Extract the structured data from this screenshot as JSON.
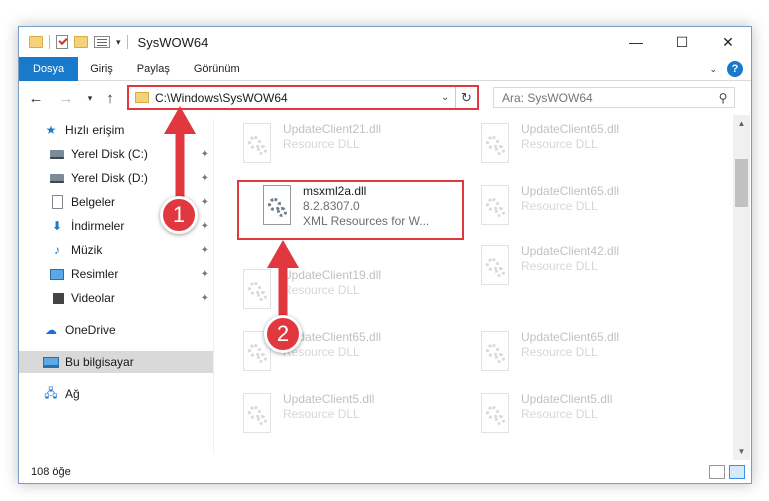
{
  "window": {
    "title": "SysWOW64",
    "controls": {
      "minimize": "—",
      "maximize": "☐",
      "close": "✕"
    }
  },
  "ribbon": {
    "tabs": [
      "Dosya",
      "Giriş",
      "Paylaş",
      "Görünüm"
    ],
    "help": "?"
  },
  "address": {
    "path": "C:\\Windows\\SysWOW64",
    "search_placeholder": "Ara: SysWOW64"
  },
  "sidebar": {
    "quick_access": "Hızlı erişim",
    "items": [
      {
        "label": "Yerel Disk (C:)",
        "icon": "disk-icon",
        "pinned": true
      },
      {
        "label": "Yerel Disk (D:)",
        "icon": "disk-icon",
        "pinned": true
      },
      {
        "label": "Belgeler",
        "icon": "documents-icon",
        "pinned": true
      },
      {
        "label": "İndirmeler",
        "icon": "downloads-icon",
        "pinned": true
      },
      {
        "label": "Müzik",
        "icon": "music-icon",
        "pinned": true
      },
      {
        "label": "Resimler",
        "icon": "pictures-icon",
        "pinned": true
      },
      {
        "label": "Videolar",
        "icon": "videos-icon",
        "pinned": true
      }
    ],
    "onedrive": "OneDrive",
    "this_pc": "Bu bilgisayar",
    "network": "Ağ"
  },
  "files": {
    "highlighted": {
      "name": "msxml2a.dll",
      "version": "8.2.8307.0",
      "description": "XML Resources for W..."
    },
    "faded": [
      {
        "name": "UpdateClient21.dll",
        "type": "Resource DLL"
      },
      {
        "name": "UpdateClient65.dll",
        "type": "Resource DLL"
      },
      {
        "name": "UpdateClient65.dll",
        "type": "Resource DLL"
      },
      {
        "name": "UpdateClient42.dll",
        "type": "Resource DLL"
      },
      {
        "name": "UpdateClient19.dll",
        "type": "Resource DLL"
      },
      {
        "name": "UpdateClient65.dll",
        "type": "Resource DLL"
      },
      {
        "name": "UpdateClient65.dll",
        "type": "Resource DLL"
      },
      {
        "name": "UpdateClient5.dll",
        "type": "Resource DLL"
      },
      {
        "name": "UpdateClient5.dll",
        "type": "Resource DLL"
      }
    ]
  },
  "status": {
    "count": "108 öğe"
  },
  "callouts": {
    "one": "1",
    "two": "2"
  },
  "colors": {
    "accent": "#1979ca",
    "callout": "#e0383e"
  }
}
